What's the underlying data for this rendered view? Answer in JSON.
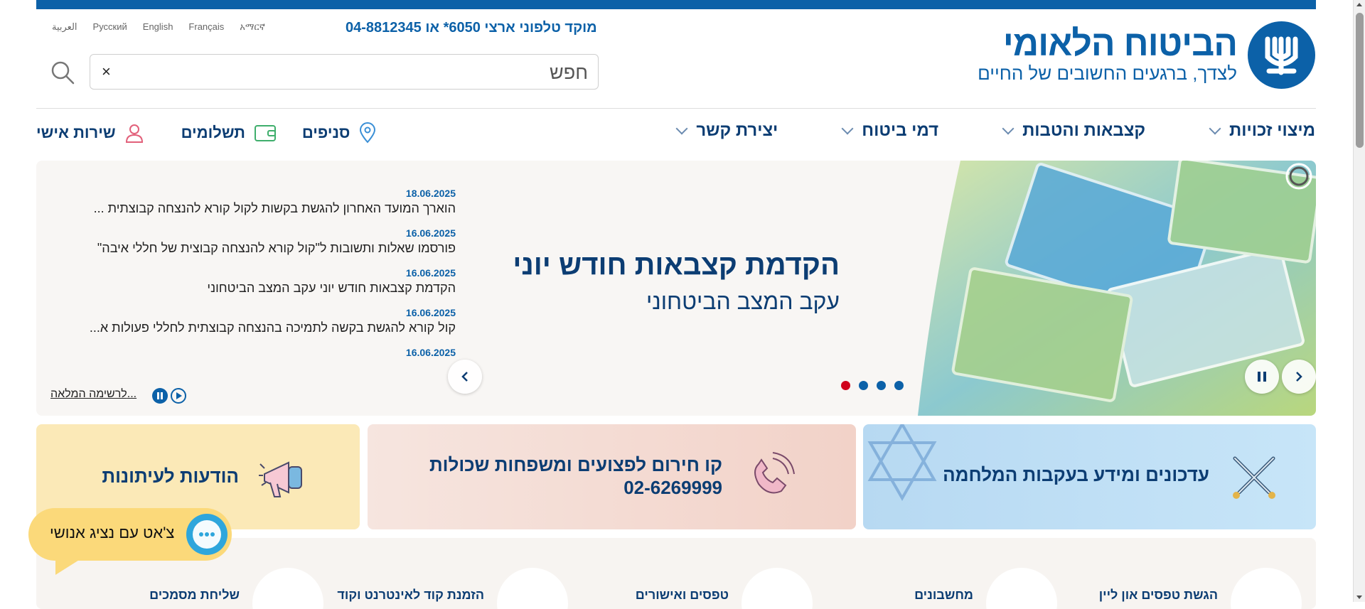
{
  "header": {
    "logo_title": "הביטוח הלאומי",
    "logo_subtitle": "לצדך, ברגעים החשובים של החיים",
    "phone": "מוקד טלפוני ארצי 6050* או 04-8812345",
    "languages": [
      "العربية",
      "Русский",
      "English",
      "Français",
      "አማርኛ"
    ],
    "search_placeholder": "חפש",
    "search_clear": "×"
  },
  "nav": {
    "main": [
      {
        "label": "מיצוי זכויות"
      },
      {
        "label": "קצבאות והטבות"
      },
      {
        "label": "דמי ביטוח"
      },
      {
        "label": "יצירת קשר"
      }
    ],
    "secondary": [
      {
        "label": "שירות אישי",
        "icon": "person-icon"
      },
      {
        "label": "תשלומים",
        "icon": "wallet-icon"
      },
      {
        "label": "סניפים",
        "icon": "location-pin-icon"
      }
    ]
  },
  "hero": {
    "title": "הקדמת קצבאות חודש יוני",
    "subtitle": "עקב המצב הביטחוני",
    "dots_count": 4,
    "active_dot": 0
  },
  "news": {
    "items": [
      {
        "date": "18.06.2025",
        "text": "הוארך המועד האחרון להגשת בקשות לקול קורא להנצחה קבוצתית ..."
      },
      {
        "date": "16.06.2025",
        "text": "פורסמו שאלות ותשובות ל\"קול קורא להנצחה קבוצית של חללי איבה\""
      },
      {
        "date": "16.06.2025",
        "text": "הקדמת קצבאות חודש יוני עקב המצב הביטחוני"
      },
      {
        "date": "16.06.2025",
        "text": "קול קורא להגשת בקשה לתמיכה בהנצחה קבוצתית לחללי פעולות א..."
      },
      {
        "date": "16.06.2025",
        "text": ""
      }
    ],
    "full_list": "לרשימה המלאה..."
  },
  "cards": {
    "war_updates": "עדכונים ומידע בעקבות המלחמה",
    "emergency_line": "קו חירום לפצועים ומשפחות שכולות",
    "emergency_phone": "02-6269999",
    "press": "הודעות לעיתונות"
  },
  "chat": {
    "label": "צ'אט עם נציג אנושי"
  },
  "quick_links": [
    {
      "label": "הגשת טפסים און ליין"
    },
    {
      "label": "מחשבונים"
    },
    {
      "label": "טפסים ואישורים"
    },
    {
      "label": "הזמנת קוד לאינטרנט וקוד"
    },
    {
      "label": "שליחת מסמכים"
    }
  ],
  "colors": {
    "brand_blue": "#0c61a8",
    "dark_blue": "#0c3d73",
    "active_dot": "#d0021b",
    "chat_yellow": "#fbd97a"
  }
}
